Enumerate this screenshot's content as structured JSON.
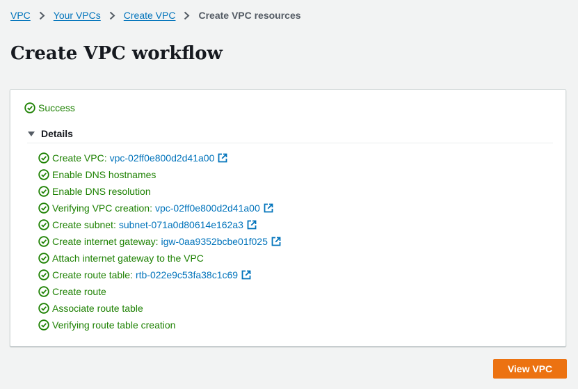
{
  "breadcrumb": {
    "items": [
      "VPC",
      "Your VPCs",
      "Create VPC"
    ],
    "current": "Create VPC resources"
  },
  "page": {
    "title": "Create VPC workflow"
  },
  "status": {
    "label": "Success"
  },
  "details": {
    "label": "Details",
    "steps": [
      {
        "text": "Create VPC:",
        "link": "vpc-02ff0e800d2d41a00"
      },
      {
        "text": "Enable DNS hostnames",
        "link": null
      },
      {
        "text": "Enable DNS resolution",
        "link": null
      },
      {
        "text": "Verifying VPC creation:",
        "link": "vpc-02ff0e800d2d41a00"
      },
      {
        "text": "Create subnet:",
        "link": "subnet-071a0d80614e162a3"
      },
      {
        "text": "Create internet gateway:",
        "link": "igw-0aa9352bcbe01f025"
      },
      {
        "text": "Attach internet gateway to the VPC",
        "link": null
      },
      {
        "text": "Create route table:",
        "link": "rtb-022e9c53fa38c1c69"
      },
      {
        "text": "Create route",
        "link": null
      },
      {
        "text": "Associate route table",
        "link": null
      },
      {
        "text": "Verifying route table creation",
        "link": null
      }
    ]
  },
  "actions": {
    "view_vpc": "View VPC"
  },
  "icons": {
    "status": "check-circle-icon",
    "external": "external-link-icon",
    "expand": "caret-down-icon",
    "separator": "chevron-right-icon"
  },
  "colors": {
    "success": "#1d8102",
    "link": "#0073bb",
    "primary": "#ec7211",
    "background": "#f2f3f3"
  }
}
